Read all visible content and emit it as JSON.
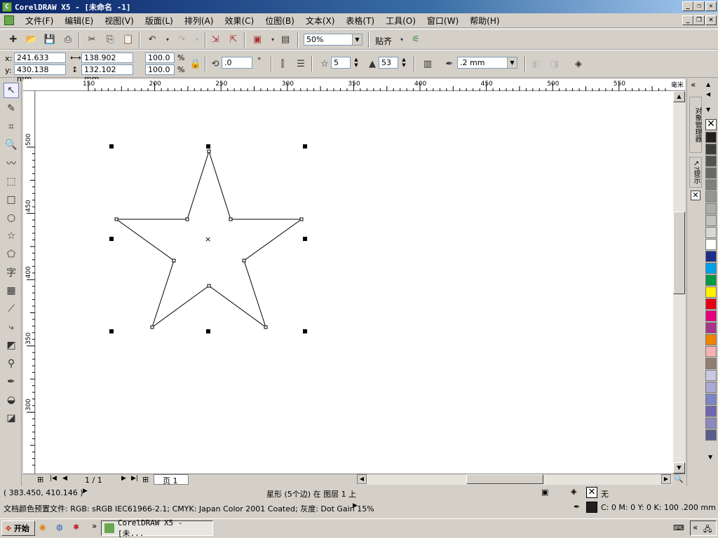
{
  "window": {
    "title": "CorelDRAW X5 - [未命名 -1]",
    "app_icon": "coreldraw-icon"
  },
  "menu": [
    "文件(F)",
    "编辑(E)",
    "视图(V)",
    "版面(L)",
    "排列(A)",
    "效果(C)",
    "位图(B)",
    "文本(X)",
    "表格(T)",
    "工具(O)",
    "窗口(W)",
    "帮助(H)"
  ],
  "standard_toolbar": {
    "zoom": "50%",
    "snap_label": "贴齐"
  },
  "property_bar": {
    "x_label": "x:",
    "x": "241.633 mm",
    "y_label": "y:",
    "y": "430.138 mm",
    "width": "138.902 mm",
    "height": "132.102 mm",
    "scale_x": "100.0",
    "scale_y": "100.0",
    "percent": "%",
    "rotation": ".0",
    "degree": "°",
    "points": "5",
    "sharpness": "53",
    "outline_width": ".2 mm"
  },
  "ruler": {
    "unit": "毫米",
    "h_ticks": [
      "150",
      "200",
      "250",
      "300",
      "350",
      "400",
      "450",
      "500",
      "550"
    ],
    "v_ticks": [
      "500",
      "450",
      "400",
      "350",
      "300"
    ]
  },
  "page_nav": {
    "counter": "1 / 1",
    "tab": "页 1"
  },
  "docker": {
    "object_manager": "对象管理器",
    "hints": "提示"
  },
  "palette": {
    "colors": [
      "#231f20",
      "#3d3d3d",
      "#535353",
      "#696969",
      "#808080",
      "#969696",
      "#acacac",
      "#c2c2c2",
      "#d8d8d8",
      "#ffffff",
      "#1c2e8a",
      "#00a0e9",
      "#009944",
      "#fff100",
      "#e60012",
      "#e4007f",
      "#a73489",
      "#f08300",
      "#f5b2b2",
      "#8f7f70",
      "#c9c9e3",
      "#a9a9d6",
      "#7c86c4",
      "#6f67b0",
      "#8b89c0",
      "#595e8e"
    ]
  },
  "status": {
    "coords": "( 383.450, 410.146 )",
    "object_info": "星形 (5个边) 在 图层 1 上",
    "fill_label": "无",
    "color_profile": "文档颜色预置文件: RGB: sRGB IEC61966-2.1; CMYK: Japan Color 2001 Coated; 灰度: Dot Gain 15%",
    "outline_info": "C: 0 M: 0 Y: 0 K: 100  .200 mm"
  },
  "taskbar": {
    "start": "开始",
    "task": "CorelDRAW X5 - [未..."
  }
}
